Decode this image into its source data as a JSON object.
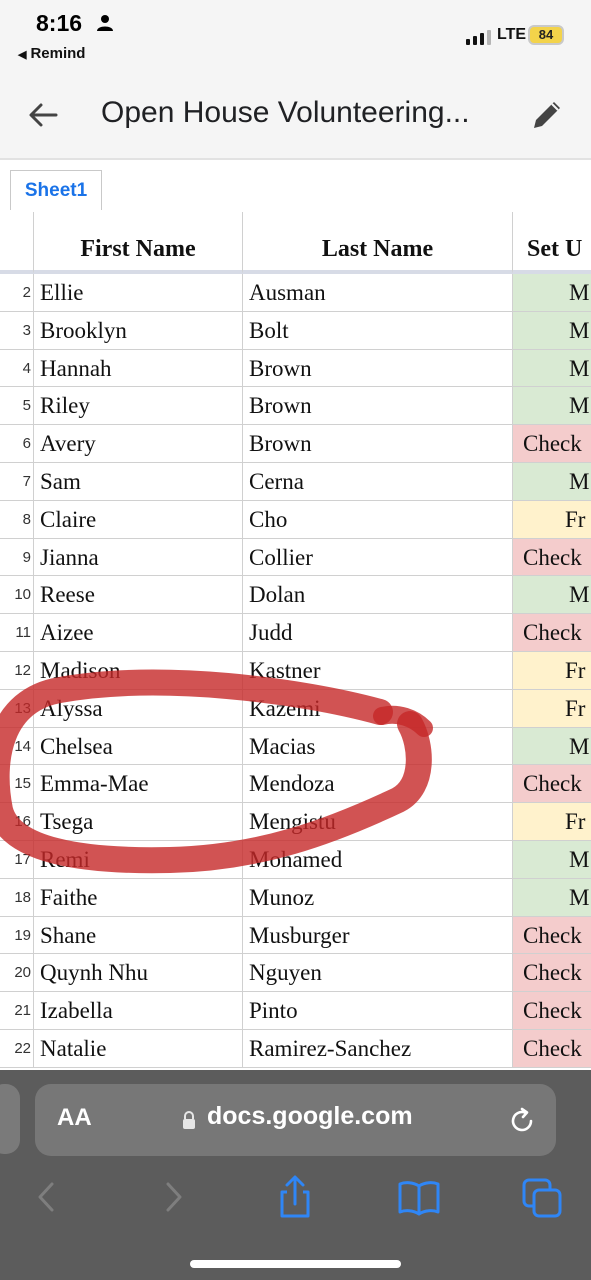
{
  "status_bar": {
    "time": "8:16",
    "back_app": "Remind",
    "network": "LTE",
    "battery": "84"
  },
  "header": {
    "title": "Open House Volunteering..."
  },
  "sheet_tabs": [
    "Sheet1"
  ],
  "table": {
    "columns": [
      "First Name",
      "Last Name",
      "Set U"
    ],
    "rows": [
      {
        "num": "2",
        "first": "Ellie",
        "last": "Ausman",
        "setup": "M",
        "color": "green"
      },
      {
        "num": "3",
        "first": "Brooklyn",
        "last": "Bolt",
        "setup": "M",
        "color": "green"
      },
      {
        "num": "4",
        "first": "Hannah",
        "last": "Brown",
        "setup": "M",
        "color": "green"
      },
      {
        "num": "5",
        "first": "Riley",
        "last": "Brown",
        "setup": "M",
        "color": "green"
      },
      {
        "num": "6",
        "first": "Avery",
        "last": "Brown",
        "setup": "Check",
        "color": "red"
      },
      {
        "num": "7",
        "first": "Sam",
        "last": "Cerna",
        "setup": "M",
        "color": "green"
      },
      {
        "num": "8",
        "first": "Claire",
        "last": "Cho",
        "setup": "Fr",
        "color": "yellow"
      },
      {
        "num": "9",
        "first": "Jianna",
        "last": "Collier",
        "setup": "Check",
        "color": "red"
      },
      {
        "num": "10",
        "first": "Reese",
        "last": "Dolan",
        "setup": "M",
        "color": "green"
      },
      {
        "num": "11",
        "first": "Aizee",
        "last": "Judd",
        "setup": "Check",
        "color": "red"
      },
      {
        "num": "12",
        "first": "Madison",
        "last": "Kastner",
        "setup": "Fr",
        "color": "yellow"
      },
      {
        "num": "13",
        "first": "Alyssa",
        "last": "Kazemi",
        "setup": "Fr",
        "color": "yellow"
      },
      {
        "num": "14",
        "first": "Chelsea",
        "last": "Macias",
        "setup": "M",
        "color": "green"
      },
      {
        "num": "15",
        "first": "Emma-Mae",
        "last": "Mendoza",
        "setup": "Check",
        "color": "red"
      },
      {
        "num": "16",
        "first": "Tsega",
        "last": "Mengistu",
        "setup": "Fr",
        "color": "yellow"
      },
      {
        "num": "17",
        "first": "Remi",
        "last": "Mohamed",
        "setup": "M",
        "color": "green"
      },
      {
        "num": "18",
        "first": "Faithe",
        "last": "Munoz",
        "setup": "M",
        "color": "green"
      },
      {
        "num": "19",
        "first": "Shane",
        "last": "Musburger",
        "setup": "Check",
        "color": "red"
      },
      {
        "num": "20",
        "first": "Quynh Nhu",
        "last": "Nguyen",
        "setup": "Check",
        "color": "red"
      },
      {
        "num": "21",
        "first": "Izabella",
        "last": "Pinto",
        "setup": "Check",
        "color": "red"
      },
      {
        "num": "22",
        "first": "Natalie",
        "last": "Ramirez-Sanchez",
        "setup": "Check",
        "color": "red"
      }
    ]
  },
  "colors": {
    "green": "#d9ead3",
    "red": "#f4cccc",
    "yellow": "#fff2cc",
    "annotation": "#c62828",
    "link_blue": "#1a73e8",
    "ios_blue": "#2f86f6"
  },
  "browser": {
    "aa_label": "AA",
    "url": "docs.google.com"
  },
  "icons": [
    "person-icon",
    "back-arrow-icon",
    "edit-pencil-icon",
    "lock-icon",
    "reload-icon",
    "back-nav-icon",
    "forward-nav-icon",
    "share-icon",
    "bookmarks-icon",
    "tabs-icon"
  ]
}
